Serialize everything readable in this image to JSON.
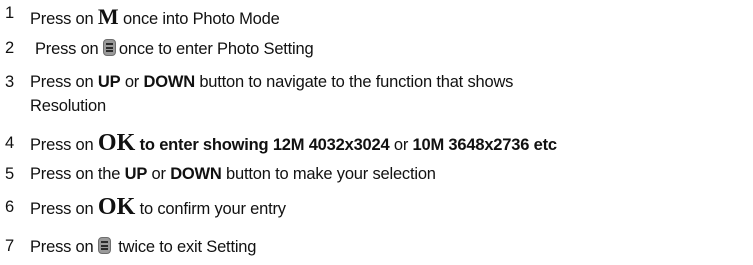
{
  "steps": [
    {
      "number": "1",
      "pre": "Press on ",
      "key": "M",
      "post": " once into Photo Mode"
    },
    {
      "number": "2",
      "pre": "Press on ",
      "icon": "menu-icon",
      "post": "once to enter Photo Setting"
    },
    {
      "number": "3",
      "pre": "Press on ",
      "key1": "UP",
      "mid": " or ",
      "key2": "DOWN",
      "post": " button to navigate to the function that shows",
      "continuation": "Resolution"
    },
    {
      "number": "4",
      "pre": "Press on ",
      "key": "OK",
      "post1": " to enter showing 12M 4032x3024",
      "mid": " or ",
      "post2": "10M 3648x2736 etc"
    },
    {
      "number": "5",
      "pre": "Press on the ",
      "key1": "UP",
      "mid": " or ",
      "key2": "DOWN",
      "post": " button to make your selection"
    },
    {
      "number": "6",
      "pre": "Press on ",
      "key": "OK",
      "post": " to confirm your entry"
    },
    {
      "number": "7",
      "pre": "Press on ",
      "icon": "menu-icon",
      "post": " twice to exit Setting"
    }
  ]
}
